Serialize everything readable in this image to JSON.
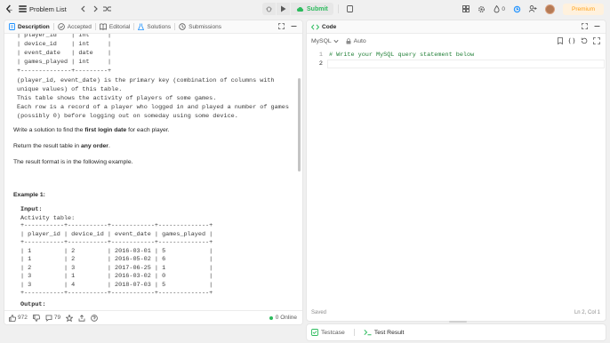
{
  "topbar": {
    "problem_list_label": "Problem List",
    "submit_label": "Submit",
    "streak_count": "0",
    "premium_label": "Premium",
    "accent_color": "#ffa116",
    "submit_color": "#2cbb5d"
  },
  "left_tabs": {
    "description": "Description",
    "accepted": "Accepted",
    "editorial": "Editorial",
    "solutions": "Solutions",
    "submissions": "Submissions"
  },
  "description": {
    "schema_tail": "| player_id    | int     |\n| device_id    | int     |\n| event_date   | date    |\n| games_played | int     |\n+--------------+---------+",
    "schema_notes": "(player_id, event_date) is the primary key (combination of columns with\nunique values) of this table.\nThis table shows the activity of players of some games.\nEach row is a record of a player who logged in and played a number of games\n(possibly 0) before logging out on someday using some device.",
    "task_prefix": "Write a solution to find the ",
    "task_bold": "first login date",
    "task_suffix": " for each player.",
    "return_prefix": "Return the result table in ",
    "return_bold": "any order",
    "return_suffix": ".",
    "format_text": "The result format is in the following example.",
    "example_heading": "Example 1:",
    "input_label": "Input:",
    "activity_label": "Activity table:",
    "example_table": "+-----------+-----------+------------+--------------+\n| player_id | device_id | event_date | games_played |\n+-----------+-----------+------------+--------------+\n| 1         | 2         | 2016-03-01 | 5            |\n| 1         | 2         | 2016-05-02 | 6            |\n| 2         | 3         | 2017-06-25 | 1            |\n| 3         | 1         | 2016-03-02 | 0            |\n| 3         | 4         | 2018-07-03 | 5            |\n+-----------+-----------+------------+--------------+",
    "output_label": "Output:",
    "output_tail": "+-----------+-------------+"
  },
  "left_footer": {
    "likes": "972",
    "comments": "79",
    "online": "0 Online"
  },
  "editor": {
    "tab_label": "Code",
    "language": "MySQL",
    "auto_label": "Auto",
    "line_numbers": [
      "1",
      "2"
    ],
    "line1": "# Write your MySQL query statement below",
    "saved_label": "Saved",
    "cursor_pos": "Ln 2, Col 1"
  },
  "bottom_panel": {
    "testcase_label": "Testcase",
    "test_result_label": "Test Result"
  }
}
